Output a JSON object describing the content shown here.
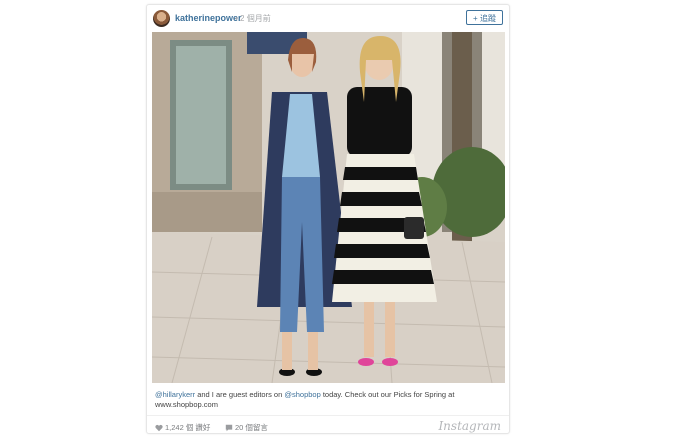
{
  "post": {
    "username": "katherinepower",
    "time_ago": "• 2 個月前",
    "follow_label": "+ 追蹤",
    "caption": {
      "mention1": "@hillarykerr",
      "text1": " and I are guest editors on ",
      "mention2": "@shopbop",
      "text2": " today. Check out our Picks for Spring at www.shopbop.com"
    },
    "likes": "1,242 個 讚好",
    "comments": "20 個留言",
    "brand": "Instagram"
  },
  "icons": {
    "likes": "heart-icon",
    "comments": "speech-bubble-icon"
  },
  "colors": {
    "link": "#3f729b",
    "muted": "#a5a7aa"
  }
}
